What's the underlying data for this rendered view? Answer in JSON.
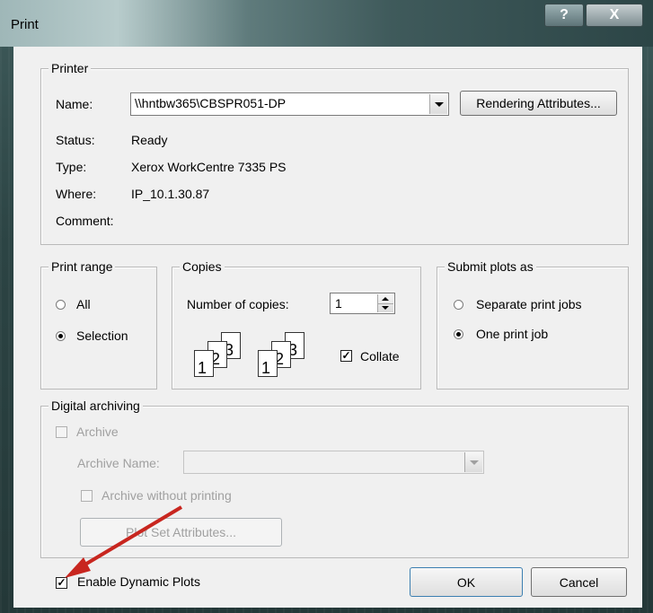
{
  "window": {
    "title": "Print",
    "help_label": "?",
    "close_label": "X"
  },
  "printer": {
    "group_label": "Printer",
    "name_label": "Name:",
    "name_value": "\\\\hntbw365\\CBSPR051-DP",
    "rendering_button": "Rendering Attributes...",
    "status_label": "Status:",
    "status_value": "Ready",
    "type_label": "Type:",
    "type_value": "Xerox WorkCentre 7335 PS",
    "where_label": "Where:",
    "where_value": "IP_10.1.30.87",
    "comment_label": "Comment:"
  },
  "print_range": {
    "group_label": "Print range",
    "options": [
      {
        "label": "All",
        "selected": false
      },
      {
        "label": "Selection",
        "selected": true
      }
    ]
  },
  "copies": {
    "group_label": "Copies",
    "number_label": "Number of copies:",
    "number_value": "1",
    "collate_label": "Collate",
    "collate_checked": true,
    "page_numbers": [
      "1",
      "2",
      "3"
    ]
  },
  "submit_plots": {
    "group_label": "Submit plots as",
    "options": [
      {
        "label": "Separate print jobs",
        "selected": false
      },
      {
        "label": "One print job",
        "selected": true
      }
    ]
  },
  "digital_archiving": {
    "group_label": "Digital archiving",
    "archive_label": "Archive",
    "archive_name_label": "Archive Name:",
    "archive_without_printing_label": "Archive without printing",
    "plot_set_button": "Plot Set Attributes..."
  },
  "footer": {
    "enable_dynamic_label": "Enable Dynamic Plots",
    "enable_dynamic_checked": true,
    "ok_label": "OK",
    "cancel_label": "Cancel"
  },
  "annotation": {
    "color": "#c8261f"
  },
  "colors": {
    "frame": "#2c4444",
    "dialog_bg": "#f0f0f0",
    "disabled_text": "#a0a0a0"
  }
}
